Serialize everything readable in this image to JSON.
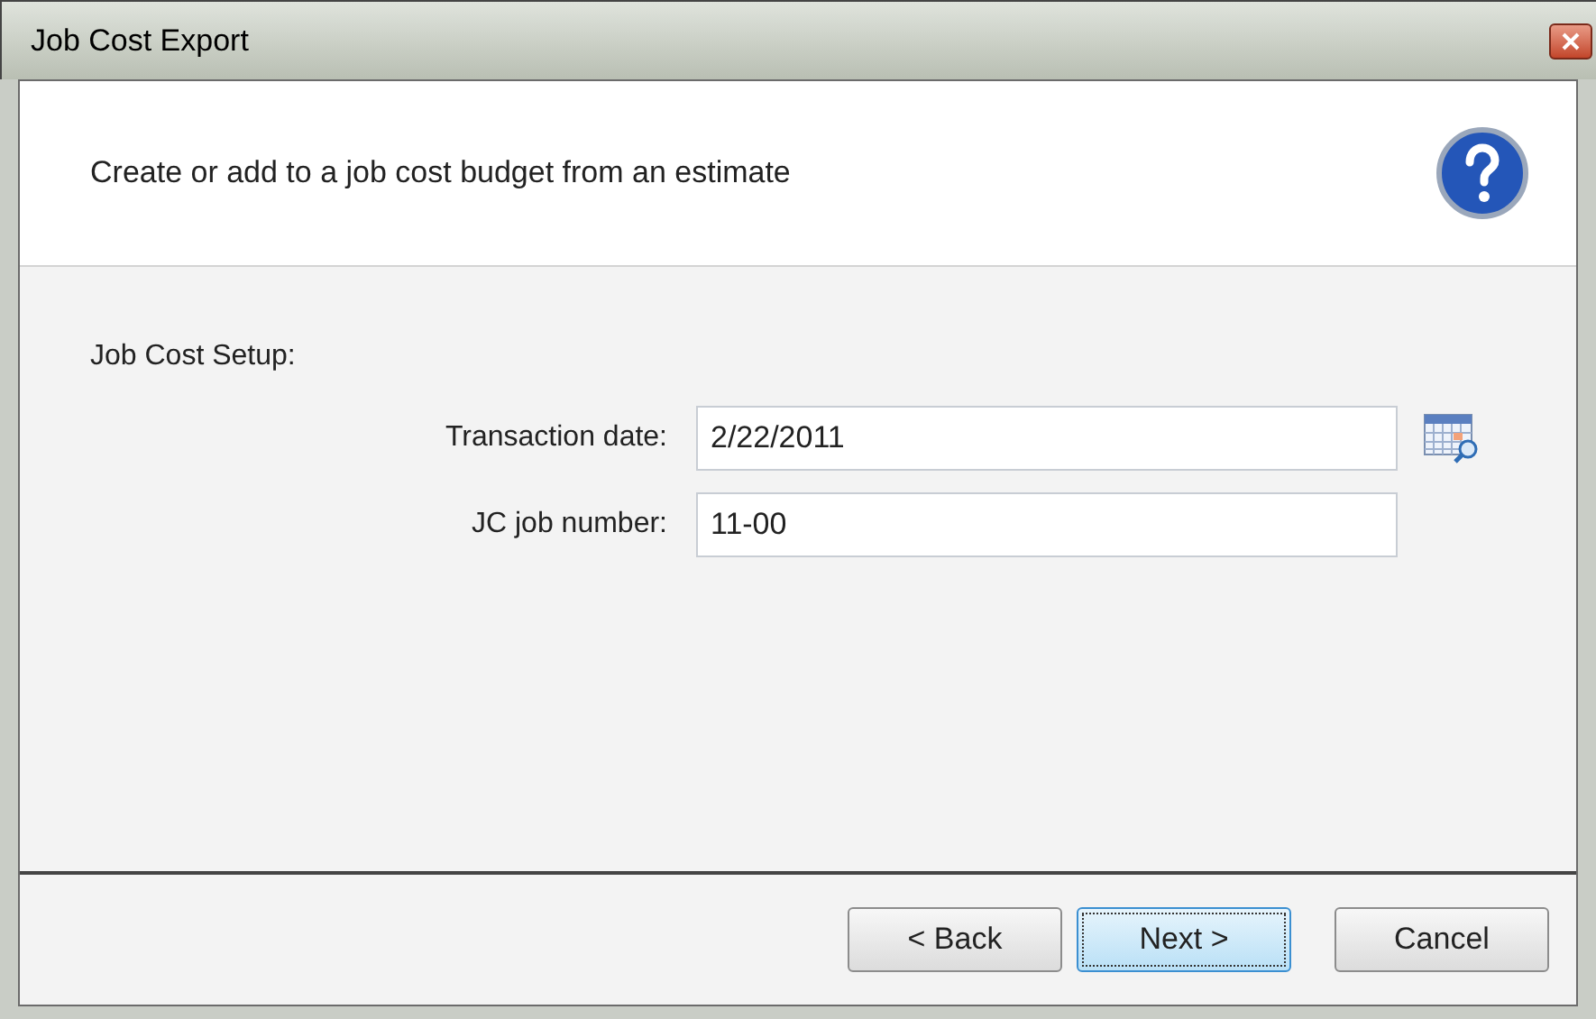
{
  "window": {
    "title": "Job Cost Export"
  },
  "header": {
    "text": "Create or add to a job cost budget from an estimate"
  },
  "section": {
    "title": "Job Cost Setup:"
  },
  "fields": [
    {
      "label": "Transaction date:",
      "value": "2/22/2011",
      "kind": "date"
    },
    {
      "label": "JC job number:",
      "value": "11-00",
      "kind": "text"
    }
  ],
  "buttons": [
    {
      "label": "< Back",
      "default": false
    },
    {
      "label": "Next >",
      "default": true
    },
    {
      "label": "Cancel",
      "default": false
    }
  ]
}
